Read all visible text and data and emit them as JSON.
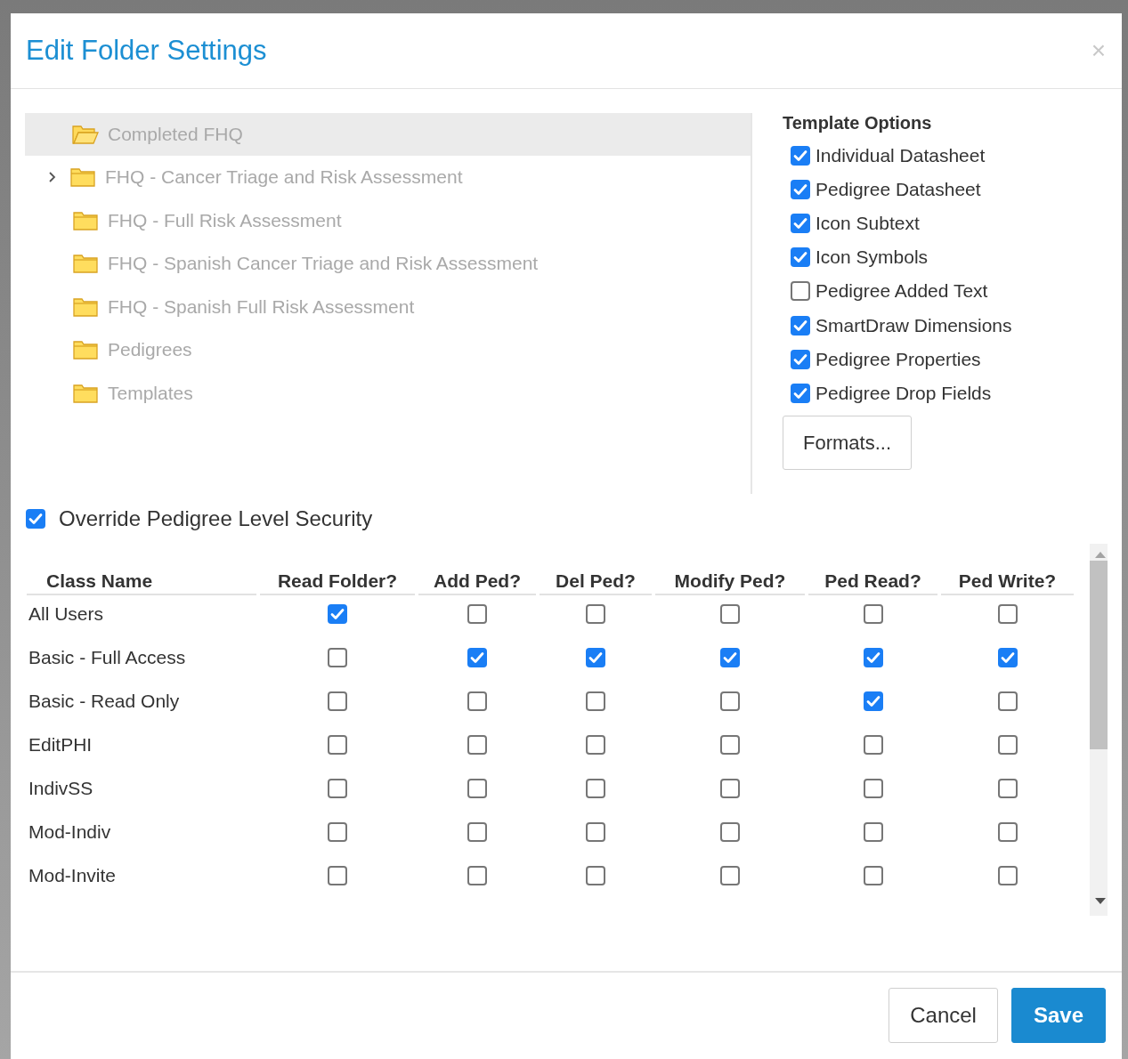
{
  "dialog": {
    "title": "Edit Folder Settings",
    "close": "×"
  },
  "tree": [
    {
      "label": "Completed FHQ",
      "kind": "leaf",
      "selected": true
    },
    {
      "label": "FHQ - Cancer Triage and Risk Assessment",
      "kind": "branch",
      "selected": false
    },
    {
      "label": "FHQ - Full Risk Assessment",
      "kind": "leaf",
      "selected": false
    },
    {
      "label": "FHQ - Spanish Cancer Triage and Risk Assessment",
      "kind": "leaf",
      "selected": false
    },
    {
      "label": "FHQ - Spanish Full Risk Assessment",
      "kind": "leaf",
      "selected": false
    },
    {
      "label": "Pedigrees",
      "kind": "leaf",
      "selected": false
    },
    {
      "label": "Templates",
      "kind": "leaf",
      "selected": false
    }
  ],
  "template_options": {
    "title": "Template Options",
    "options": [
      {
        "label": "Individual Datasheet",
        "checked": true
      },
      {
        "label": "Pedigree Datasheet",
        "checked": true
      },
      {
        "label": "Icon Subtext",
        "checked": true
      },
      {
        "label": "Icon Symbols",
        "checked": true
      },
      {
        "label": "Pedigree Added Text",
        "checked": false
      },
      {
        "label": "SmartDraw Dimensions",
        "checked": true
      },
      {
        "label": "Pedigree Properties",
        "checked": true
      },
      {
        "label": "Pedigree Drop Fields",
        "checked": true
      }
    ],
    "button": "Formats..."
  },
  "override": {
    "label": "Override Pedigree Level Security",
    "checked": true
  },
  "table": {
    "columns": [
      "Class Name",
      "Read Folder?",
      "Add Ped?",
      "Del Ped?",
      "Modify Ped?",
      "Ped Read?",
      "Ped Write?"
    ],
    "rows": [
      {
        "name": "All Users",
        "values": [
          true,
          false,
          false,
          false,
          false,
          false
        ]
      },
      {
        "name": "Basic - Full Access",
        "values": [
          false,
          true,
          true,
          true,
          true,
          true
        ]
      },
      {
        "name": "Basic - Read Only",
        "values": [
          false,
          false,
          false,
          false,
          true,
          false
        ]
      },
      {
        "name": "EditPHI",
        "values": [
          false,
          false,
          false,
          false,
          false,
          false
        ]
      },
      {
        "name": "IndivSS",
        "values": [
          false,
          false,
          false,
          false,
          false,
          false
        ]
      },
      {
        "name": "Mod-Indiv",
        "values": [
          false,
          false,
          false,
          false,
          false,
          false
        ]
      },
      {
        "name": "Mod-Invite",
        "values": [
          false,
          false,
          false,
          false,
          false,
          false
        ]
      }
    ]
  },
  "buttons": [
    {
      "label": "Cancel",
      "kind": "secondary"
    },
    {
      "label": "Save",
      "kind": "primary"
    }
  ]
}
